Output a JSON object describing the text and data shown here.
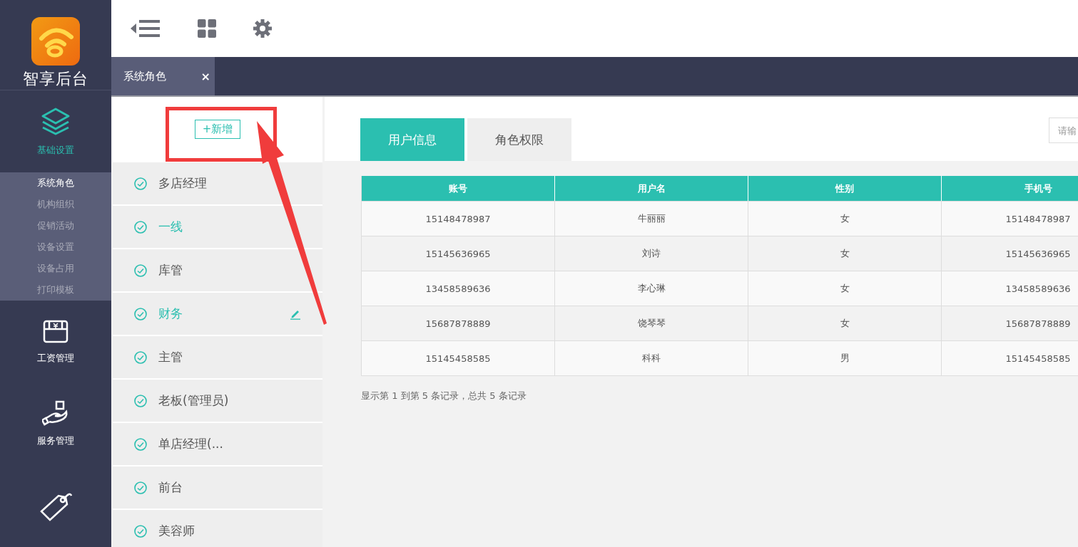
{
  "app": {
    "title": "智享后台"
  },
  "nav": [
    {
      "kind": "layers",
      "label": "基础设置",
      "selected": true,
      "children": [
        {
          "label": "系统角色",
          "selected": true
        },
        {
          "label": "机构组织",
          "selected": false
        },
        {
          "label": "促销活动",
          "selected": false
        },
        {
          "label": "设备设置",
          "selected": false
        },
        {
          "label": "设备占用",
          "selected": false
        },
        {
          "label": "打印模板",
          "selected": false
        }
      ]
    },
    {
      "kind": "wallet",
      "label": "工资管理",
      "selected": false
    },
    {
      "kind": "service",
      "label": "服务管理",
      "selected": false
    },
    {
      "kind": "sale",
      "selected": false
    }
  ],
  "page_tabs": [
    {
      "label": "系统角色",
      "close": "×",
      "selected": true
    }
  ],
  "add_button": "+新增",
  "roles": [
    {
      "label": "多店经理",
      "selected": false,
      "editable": false
    },
    {
      "label": "一线",
      "selected": true,
      "editable": false
    },
    {
      "label": "库管",
      "selected": false,
      "editable": false
    },
    {
      "label": "财务",
      "selected": true,
      "editable": true
    },
    {
      "label": "主管",
      "selected": false,
      "editable": false
    },
    {
      "label": "老板(管理员)",
      "selected": false,
      "editable": false
    },
    {
      "label": "单店经理(...",
      "selected": false,
      "editable": false
    },
    {
      "label": "前台",
      "selected": false,
      "editable": false
    },
    {
      "label": "美容师",
      "selected": false,
      "editable": false
    }
  ],
  "tabs": [
    {
      "label": "用户信息",
      "selected": true
    },
    {
      "label": "角色权限",
      "selected": false
    }
  ],
  "search": {
    "placeholder": "请输"
  },
  "table": {
    "columns": [
      "账号",
      "用户名",
      "性别",
      "手机号"
    ],
    "rows": [
      [
        "15148478987",
        "牛丽丽",
        "女",
        "15148478987"
      ],
      [
        "15145636965",
        "刘诗",
        "女",
        "15145636965"
      ],
      [
        "13458589636",
        "李心琳",
        "女",
        "13458589636"
      ],
      [
        "15687878889",
        "饶琴琴",
        "女",
        "15687878889"
      ],
      [
        "15145458585",
        "科科",
        "男",
        "15145458585"
      ]
    ]
  },
  "pagination": "显示第 1 到第 5 条记录，总共 5 条记录"
}
